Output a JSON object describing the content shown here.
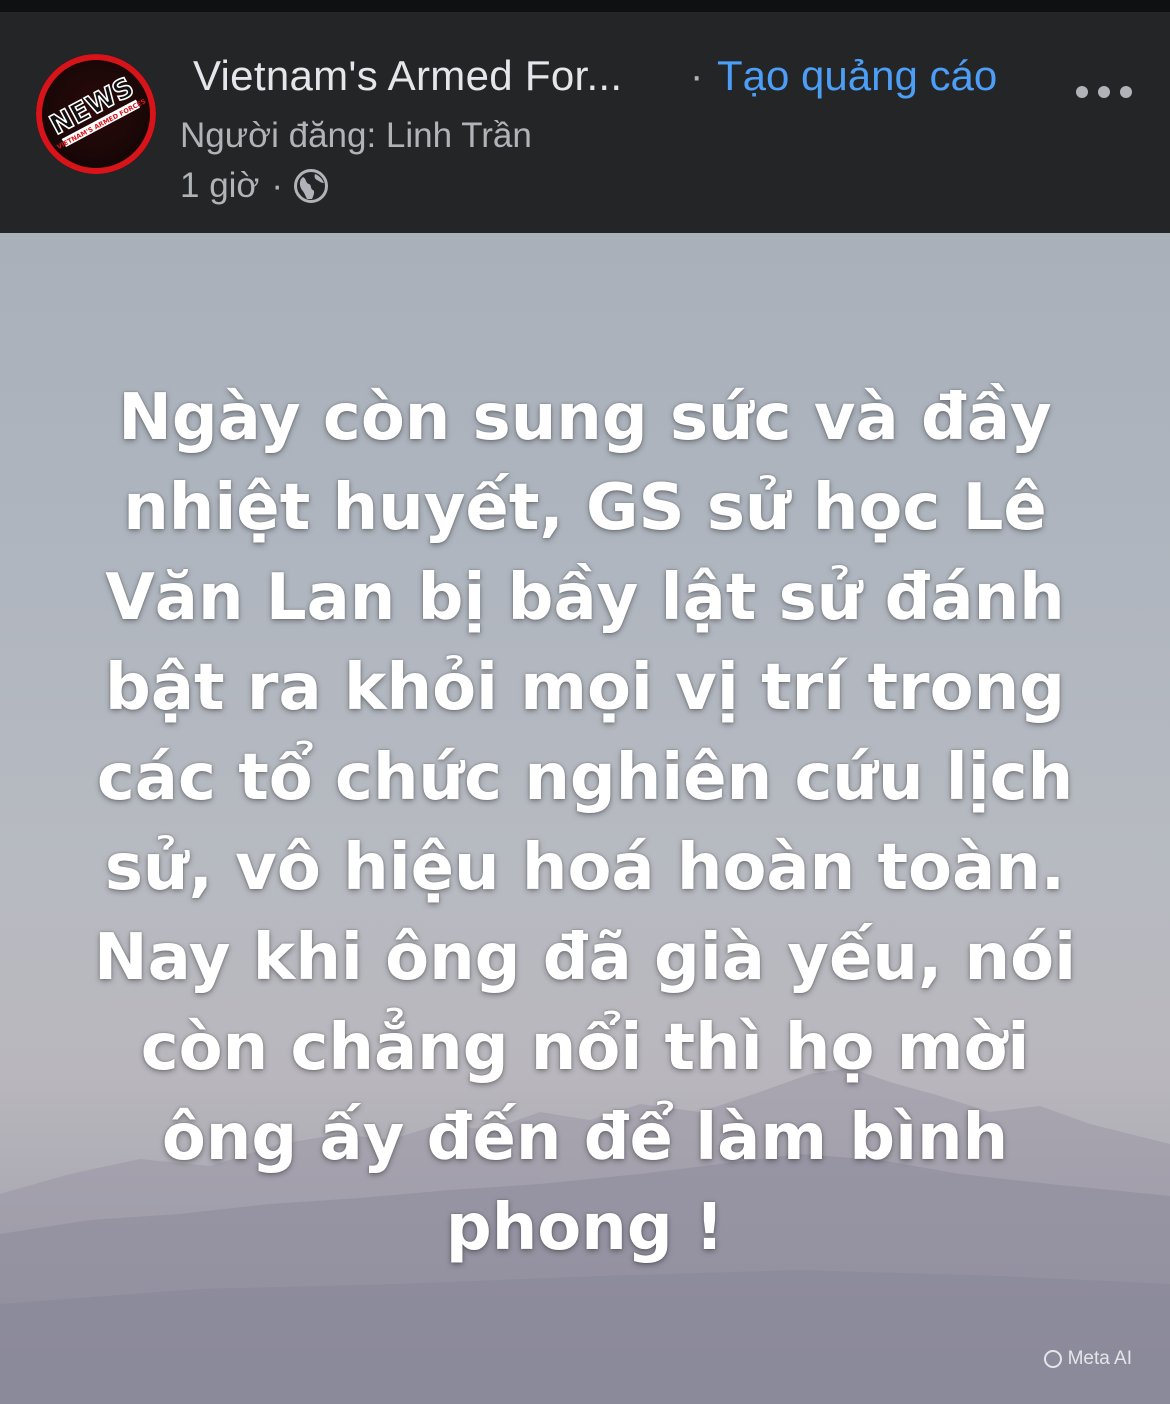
{
  "post": {
    "page_name": "Vietnam's Armed For...",
    "separator": "·",
    "create_ad_label": "Tạo quảng cáo",
    "poster_line": "Người đăng: Linh Trần",
    "time": "1 giờ",
    "time_separator": "·",
    "audience_icon": "globe-icon",
    "more_icon": "more-horizontal-icon"
  },
  "avatar": {
    "logo_text": "NEWS",
    "logo_subtext": "VIETNAM'S ARMED FORCES",
    "colors": {
      "ring": "#d8141b",
      "text_stroke": "#ffffff"
    }
  },
  "image": {
    "text": "Ngày còn sung sức và đầy\nnhiệt huyết, GS sử học Lê\nVăn Lan bị bầy lật sử đánh\nbật ra khỏi mọi vị trí trong\ncác tổ chức nghiên cứu lịch\nsử, vô hiệu hoá hoàn toàn.\nNay khi ông đã già yếu, nói\ncòn chẳng nổi thì họ mời\nông ấy đến để làm bình\nphong !",
    "watermark": "Meta AI"
  },
  "colors": {
    "header_bg": "#242526",
    "primary_text": "#e4e6eb",
    "secondary_text": "#b0b3b8",
    "link": "#4d9ef6"
  }
}
